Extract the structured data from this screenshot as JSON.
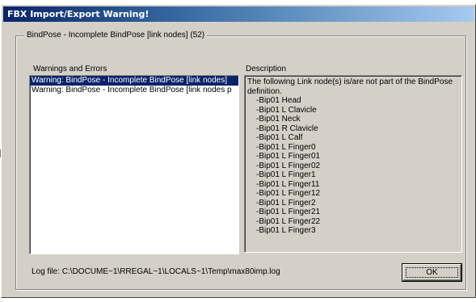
{
  "window": {
    "title": "FBX Import/Export Warning!"
  },
  "group": {
    "legend": "BindPose - Incomplete BindPose [link nodes] (52)"
  },
  "warnings": {
    "header": "Warnings and Errors",
    "items": [
      {
        "text": "Warning: BindPose - Incomplete BindPose [link nodes]",
        "selected": true
      },
      {
        "text": "Warning: BindPose - Incomplete BindPose [link nodes p",
        "selected": false
      }
    ]
  },
  "description": {
    "header": "Description",
    "intro": "The following Link node(s) is/are not part of the BindPose definition.",
    "nodes": [
      "-Bip01 Head",
      "-Bip01 L Clavicle",
      "-Bip01 Neck",
      "-Bip01 R Clavicle",
      "-Bip01 L Calf",
      "-Bip01 L Finger0",
      "-Bip01 L Finger01",
      "-Bip01 L Finger02",
      "-Bip01 L Finger1",
      "-Bip01 L Finger11",
      "-Bip01 L Finger12",
      "-Bip01 L Finger2",
      "-Bip01 L Finger21",
      "-Bip01 L Finger22",
      "-Bip01 L Finger3"
    ]
  },
  "footer": {
    "log_file": "Log file: C:\\DOCUME~1\\RREGAL~1\\LOCALS~1\\Temp\\max80imp.log",
    "ok_label": "OK"
  }
}
